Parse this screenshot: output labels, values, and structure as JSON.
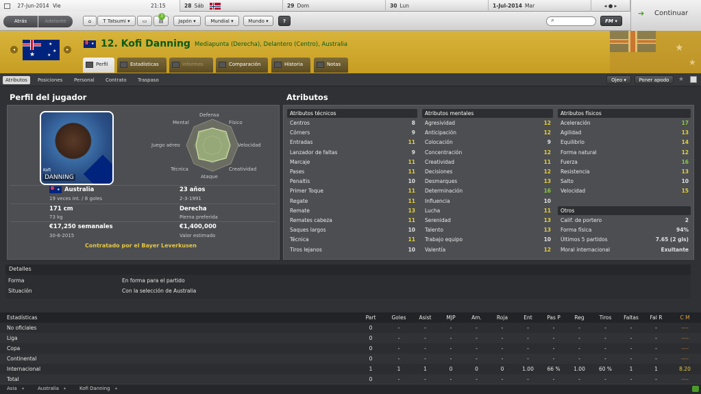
{
  "calendar": {
    "date": "27-Jun-2014",
    "dow": "Vie",
    "time": "21:15",
    "days": [
      {
        "d": "28",
        "dow": "Sáb"
      },
      {
        "d": "29",
        "dow": "Dom"
      },
      {
        "d": "30",
        "dow": "Lun"
      },
      {
        "d": "1-Jul-2014",
        "dow": "Mar"
      }
    ]
  },
  "toolbar": {
    "back": "Atrás",
    "forward": "Adelante",
    "manager": "T Tatsumi",
    "badge": "3",
    "league": "Japón",
    "world_cup": "Mundial",
    "world": "Mundo",
    "help": "?",
    "fm": "FM",
    "continue": "Continuar"
  },
  "player": {
    "number_name": "12. Kofi Danning",
    "positions": "Mediapunta (Derecha), Delantero (Centro), Australia",
    "photo_name_small": "Kofi",
    "photo_name": "DANNING"
  },
  "tabs": [
    "Perfil",
    "Estadísticas",
    "Informes",
    "Comparación",
    "Historia",
    "Notas"
  ],
  "subtabs": [
    "Atributos",
    "Posiciones",
    "Personal",
    "Contrato",
    "Traspaso"
  ],
  "actions": {
    "eye": "Ojeo",
    "make_offer": "Poner apodo"
  },
  "profile": {
    "title": "Perfil del jugador",
    "nation": "Australia",
    "caps": "19 veces int. / 8 goles",
    "age": "23 años",
    "dob": "2-3-1991",
    "height": "171 cm",
    "weight": "73 kg",
    "foot": "Derecha",
    "foot_lbl": "Pierna preferida",
    "wage": "€17,250 semanales",
    "contract": "30-6-2015",
    "value": "€1,400,000",
    "value_lbl": "Valor estimado",
    "club": "Contratado por el Bayer Leverkusen"
  },
  "radar": {
    "defensa": "Defensa",
    "fisico": "Físico",
    "velocidad": "Velocidad",
    "creatividad": "Creatividad",
    "ataque": "Ataque",
    "tecnica": "Técnica",
    "aereo": "Juego aéreo",
    "mental": "Mental"
  },
  "attributes_title": "Atributos",
  "technical": {
    "title": "Atributos técnicos",
    "rows": [
      [
        "Centros",
        "8",
        "w"
      ],
      [
        "Córners",
        "9",
        "w"
      ],
      [
        "Entradas",
        "11",
        "y"
      ],
      [
        "Lanzador de faltas",
        "9",
        "w"
      ],
      [
        "Marcaje",
        "11",
        "y"
      ],
      [
        "Pases",
        "11",
        "y"
      ],
      [
        "Penaltis",
        "10",
        "w"
      ],
      [
        "Primer Toque",
        "11",
        "y"
      ],
      [
        "Regate",
        "11",
        "y"
      ],
      [
        "Remate",
        "13",
        "y"
      ],
      [
        "Remates cabeza",
        "11",
        "y"
      ],
      [
        "Saques largos",
        "10",
        "w"
      ],
      [
        "Técnica",
        "11",
        "y"
      ],
      [
        "Tiros lejanos",
        "10",
        "w"
      ]
    ]
  },
  "mental": {
    "title": "Atributos mentales",
    "rows": [
      [
        "Agresividad",
        "12",
        "y"
      ],
      [
        "Anticipación",
        "12",
        "y"
      ],
      [
        "Colocación",
        "9",
        "w"
      ],
      [
        "Concentración",
        "12",
        "y"
      ],
      [
        "Creatividad",
        "11",
        "y"
      ],
      [
        "Decisiones",
        "12",
        "y"
      ],
      [
        "Desmarques",
        "13",
        "y"
      ],
      [
        "Determinación",
        "16",
        "g"
      ],
      [
        "Influencia",
        "10",
        "w"
      ],
      [
        "Lucha",
        "11",
        "y"
      ],
      [
        "Serenidad",
        "13",
        "y"
      ],
      [
        "Talento",
        "13",
        "y"
      ],
      [
        "Trabajo equipo",
        "10",
        "w"
      ],
      [
        "Valentía",
        "12",
        "y"
      ]
    ]
  },
  "physical": {
    "title": "Atributos físicos",
    "rows": [
      [
        "Aceleración",
        "17",
        "g"
      ],
      [
        "Agilidad",
        "13",
        "y"
      ],
      [
        "Equilibrio",
        "14",
        "y"
      ],
      [
        "Forma natural",
        "12",
        "y"
      ],
      [
        "Fuerza",
        "16",
        "g"
      ],
      [
        "Resistencia",
        "13",
        "y"
      ],
      [
        "Salto",
        "10",
        "w"
      ],
      [
        "Velocidad",
        "15",
        "y"
      ]
    ]
  },
  "others": {
    "title": "Otros",
    "rows": [
      [
        "Calif. de portero",
        "2"
      ],
      [
        "Forma física",
        "94%"
      ],
      [
        "Últimos 5 partidos",
        "7.65 (2 gls)"
      ],
      [
        "Moral internacional",
        "Exultante"
      ]
    ]
  },
  "details": {
    "title": "Detalles",
    "rows": [
      [
        "Forma",
        "En forma para el partido"
      ],
      [
        "Situación",
        "Con la selección de Australia"
      ]
    ]
  },
  "stats": {
    "headers": [
      "Estadísticas",
      "Part",
      "Goles",
      "Asist",
      "MJP",
      "Am.",
      "Roja",
      "Ent",
      "Pas P",
      "Reg",
      "Tiros",
      "Faltas",
      "Fal R",
      "C M"
    ],
    "rows": [
      [
        "No oficiales",
        "0",
        "-",
        "-",
        "-",
        "-",
        "-",
        "-",
        "-",
        "-",
        "-",
        "-",
        "-",
        "----"
      ],
      [
        "Liga",
        "0",
        "-",
        "-",
        "-",
        "-",
        "-",
        "-",
        "-",
        "-",
        "-",
        "-",
        "-",
        "----"
      ],
      [
        "Copa",
        "0",
        "-",
        "-",
        "-",
        "-",
        "-",
        "-",
        "-",
        "-",
        "-",
        "-",
        "-",
        "----"
      ],
      [
        "Continental",
        "0",
        "-",
        "-",
        "-",
        "-",
        "-",
        "-",
        "-",
        "-",
        "-",
        "-",
        "-",
        "----"
      ],
      [
        "Internacional",
        "1",
        "1",
        "1",
        "0",
        "0",
        "0",
        "1.00",
        "66 %",
        "1.00",
        "60 %",
        "1",
        "1",
        "8.20"
      ],
      [
        "Total",
        "0",
        "-",
        "-",
        "-",
        "-",
        "-",
        "-",
        "-",
        "-",
        "-",
        "-",
        "-",
        "----"
      ]
    ]
  },
  "breadcrumb": [
    "Asia",
    "Australia",
    "Kofi Danning"
  ]
}
